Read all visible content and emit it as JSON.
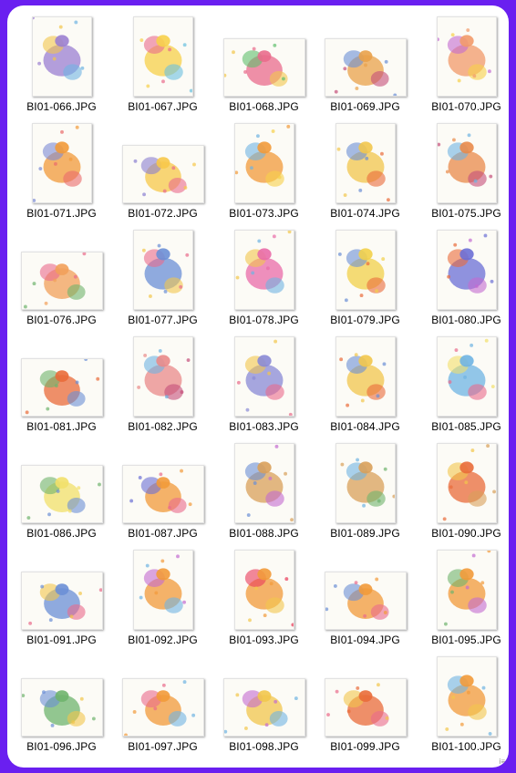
{
  "window": {
    "background": "#6a1ff0",
    "panel_background": "#ffffff",
    "corner_mark": "ⅰ≡"
  },
  "files": [
    {
      "name": "BI01-066.JPG",
      "shape": "portrait-sq",
      "icon": "star-figure-art",
      "colors": [
        "#9b7fd1",
        "#f2c64c",
        "#6fb4e3"
      ]
    },
    {
      "name": "BI01-067.JPG",
      "shape": "portrait",
      "icon": "sun-face-art",
      "colors": [
        "#f7d04a",
        "#e96b8c",
        "#6ac0e0"
      ]
    },
    {
      "name": "BI01-068.JPG",
      "shape": "landscape",
      "icon": "fish-art",
      "colors": [
        "#e96b8c",
        "#5fbf6d",
        "#f2c64c"
      ]
    },
    {
      "name": "BI01-069.JPG",
      "shape": "landscape",
      "icon": "tea-cup-art",
      "colors": [
        "#e9a14a",
        "#6b8fd6",
        "#c44f7a"
      ]
    },
    {
      "name": "BI01-070.JPG",
      "shape": "portrait",
      "icon": "birthday-cake-art",
      "colors": [
        "#f29a6a",
        "#c36bd1",
        "#f7d04a"
      ]
    },
    {
      "name": "BI01-071.JPG",
      "shape": "portrait",
      "icon": "candle-egg-art",
      "colors": [
        "#f29a3a",
        "#7b8ad6",
        "#e96b6b"
      ]
    },
    {
      "name": "BI01-072.JPG",
      "shape": "landscape",
      "icon": "sun-balloon-art",
      "colors": [
        "#f7c84a",
        "#8a7fd1",
        "#e96b8c"
      ]
    },
    {
      "name": "BI01-073.JPG",
      "shape": "portrait",
      "icon": "sun-cloud-art",
      "colors": [
        "#f29a3a",
        "#6fb4e3",
        "#f7d04a"
      ]
    },
    {
      "name": "BI01-074.JPG",
      "shape": "portrait",
      "icon": "trumpet-figure-art",
      "colors": [
        "#f2c64c",
        "#6b8fd6",
        "#e96b3a"
      ]
    },
    {
      "name": "BI01-075.JPG",
      "shape": "portrait",
      "icon": "striped-figure-art",
      "colors": [
        "#e98a4a",
        "#6fb4e3",
        "#c44f7a"
      ]
    },
    {
      "name": "BI01-076.JPG",
      "shape": "landscape",
      "icon": "cart-art",
      "colors": [
        "#f2a05a",
        "#e96b8c",
        "#6fb46d"
      ]
    },
    {
      "name": "BI01-077.JPG",
      "shape": "portrait",
      "icon": "juggler-art",
      "colors": [
        "#6b8fd6",
        "#e96b8c",
        "#f2c64c"
      ]
    },
    {
      "name": "BI01-078.JPG",
      "shape": "portrait",
      "icon": "lady-dress-art",
      "colors": [
        "#e96ba8",
        "#f2c64c",
        "#6fb4e3"
      ]
    },
    {
      "name": "BI01-079.JPG",
      "shape": "portrait",
      "icon": "moon-figure-art",
      "colors": [
        "#f2d04a",
        "#6b8fd6",
        "#e96b3a"
      ]
    },
    {
      "name": "BI01-080.JPG",
      "shape": "portrait",
      "icon": "dancing-figure-art",
      "colors": [
        "#6b6fd6",
        "#e96b3a",
        "#c36bd1"
      ]
    },
    {
      "name": "BI01-081.JPG",
      "shape": "landscape",
      "icon": "two-kids-art",
      "colors": [
        "#e96b3a",
        "#6fb46d",
        "#6b8fd6"
      ]
    },
    {
      "name": "BI01-082.JPG",
      "shape": "portrait",
      "icon": "elephant-art",
      "colors": [
        "#e98a8a",
        "#6fb4e3",
        "#c44f7a"
      ]
    },
    {
      "name": "BI01-083.JPG",
      "shape": "portrait",
      "icon": "circus-elephant-art",
      "colors": [
        "#8a8ad6",
        "#f2c64c",
        "#e96b8c"
      ]
    },
    {
      "name": "BI01-084.JPG",
      "shape": "portrait",
      "icon": "moon-cat-art",
      "colors": [
        "#f2c64c",
        "#6b8fd6",
        "#e96b3a"
      ]
    },
    {
      "name": "BI01-085.JPG",
      "shape": "portrait",
      "icon": "bird-scroll-art",
      "colors": [
        "#6fb4e3",
        "#f2e06a",
        "#e96b8c"
      ]
    },
    {
      "name": "BI01-086.JPG",
      "shape": "landscape",
      "icon": "striped-cat-art",
      "colors": [
        "#f2e06a",
        "#6fb46d",
        "#6b8fd6"
      ]
    },
    {
      "name": "BI01-087.JPG",
      "shape": "landscape",
      "icon": "flying-cat-art",
      "colors": [
        "#f29a3a",
        "#6b6fd6",
        "#e96b8c"
      ]
    },
    {
      "name": "BI01-088.JPG",
      "shape": "portrait",
      "icon": "teddy-bear-art",
      "colors": [
        "#d9a05a",
        "#6b8fd6",
        "#c36bd1"
      ]
    },
    {
      "name": "BI01-089.JPG",
      "shape": "portrait",
      "icon": "bear-window-art",
      "colors": [
        "#d9a05a",
        "#6fb4e3",
        "#6fb46d"
      ]
    },
    {
      "name": "BI01-090.JPG",
      "shape": "portrait",
      "icon": "cake-slice-art",
      "colors": [
        "#e96b3a",
        "#f2c64c",
        "#d9a05a"
      ]
    },
    {
      "name": "BI01-091.JPG",
      "shape": "landscape",
      "icon": "envelope-art",
      "colors": [
        "#6b8fd6",
        "#f2c64c",
        "#e96b8c"
      ]
    },
    {
      "name": "BI01-092.JPG",
      "shape": "portrait",
      "icon": "cat-cake-art",
      "colors": [
        "#f29a3a",
        "#c36bd1",
        "#6fb4e3"
      ]
    },
    {
      "name": "BI01-093.JPG",
      "shape": "portrait",
      "icon": "cat-candle-art",
      "colors": [
        "#f29a3a",
        "#e93a5a",
        "#f2c64c"
      ]
    },
    {
      "name": "BI01-094.JPG",
      "shape": "landscape",
      "icon": "cat-gift-art",
      "colors": [
        "#f29a3a",
        "#6b8fd6",
        "#e96b8c"
      ]
    },
    {
      "name": "BI01-095.JPG",
      "shape": "portrait",
      "icon": "two-cats-art",
      "colors": [
        "#f29a3a",
        "#6fb46d",
        "#c36bd1"
      ]
    },
    {
      "name": "BI01-096.JPG",
      "shape": "landscape",
      "icon": "bird-meadow-art",
      "colors": [
        "#6fb46d",
        "#6b8fd6",
        "#f2c64c"
      ]
    },
    {
      "name": "BI01-097.JPG",
      "shape": "landscape",
      "icon": "cat-birthday-art",
      "colors": [
        "#f29a3a",
        "#e96b8c",
        "#6fb4e3"
      ]
    },
    {
      "name": "BI01-098.JPG",
      "shape": "landscape",
      "icon": "cats-bow-art",
      "colors": [
        "#f2c64c",
        "#c36bd1",
        "#6fb4e3"
      ]
    },
    {
      "name": "BI01-099.JPG",
      "shape": "landscape",
      "icon": "running-cats-art",
      "colors": [
        "#e96b3a",
        "#f2c64c",
        "#e96b8c"
      ]
    },
    {
      "name": "BI01-100.JPG",
      "shape": "portrait",
      "icon": "cat-flowers-art",
      "colors": [
        "#f29a3a",
        "#6fb4e3",
        "#f2c64c"
      ]
    }
  ]
}
